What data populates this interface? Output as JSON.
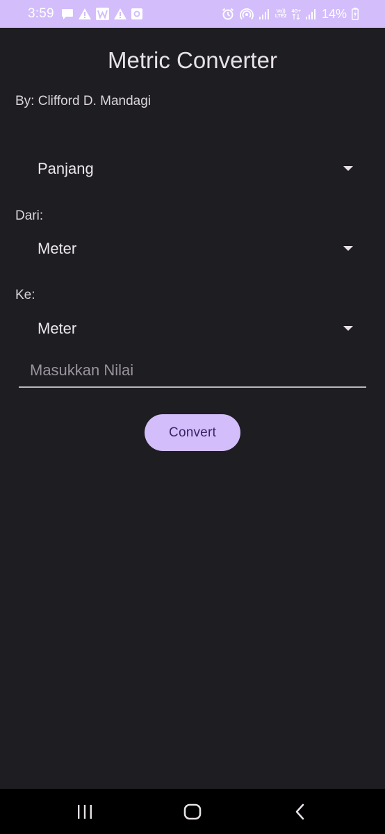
{
  "status_bar": {
    "time": "3:59",
    "left_icons": [
      "message-icon",
      "warning-icon",
      "w-app-icon",
      "warning-icon",
      "square-notification-icon"
    ],
    "right_icons": [
      "alarm-icon",
      "hotspot-icon",
      "signal-icon",
      "volte-icon",
      "4g-icon",
      "signal-icon",
      "battery-charging-icon"
    ],
    "volte_label": "Vo))",
    "volte_sub": "LTE2",
    "net_label": "4G+",
    "battery_percent": "14%",
    "background": "#d3bdfb"
  },
  "app": {
    "title": "Metric Converter",
    "author": "By: Clifford D. Mandagi"
  },
  "category_spinner": {
    "selected": "Panjang"
  },
  "from": {
    "label": "Dari:",
    "selected": "Meter"
  },
  "to": {
    "label": "Ke:",
    "selected": "Meter"
  },
  "value_input": {
    "placeholder": "Masukkan Nilai",
    "value": ""
  },
  "convert_button": {
    "label": "Convert",
    "background": "#d3bdfb",
    "text_color": "#3a2466"
  },
  "nav_bar": {
    "items": [
      "recents-icon",
      "home-icon",
      "back-icon"
    ]
  },
  "colors": {
    "background": "#1e1d22",
    "accent": "#d3bdfb"
  }
}
